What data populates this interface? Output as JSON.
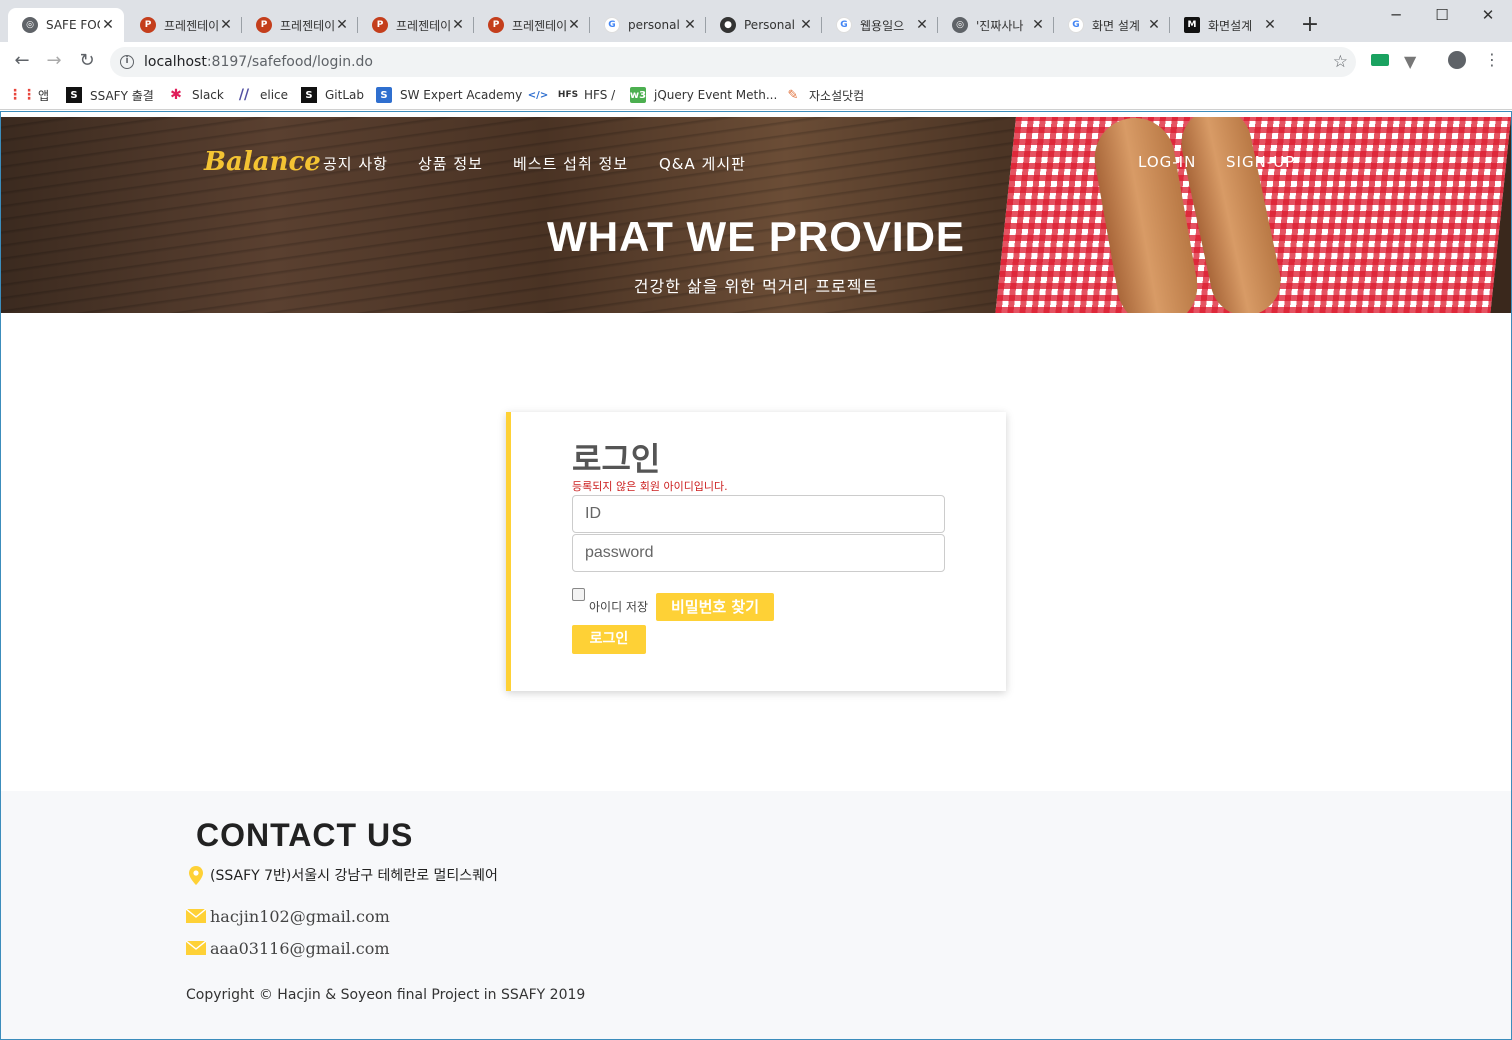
{
  "browser": {
    "tabs": [
      {
        "title": "SAFE FOOD",
        "icon": "globe-icon",
        "active": true
      },
      {
        "title": "프레젠테이션",
        "icon": "powerpoint-icon"
      },
      {
        "title": "프레젠테이션",
        "icon": "powerpoint-icon"
      },
      {
        "title": "프레젠테이션",
        "icon": "powerpoint-icon"
      },
      {
        "title": "프레젠테이션",
        "icon": "powerpoint-icon"
      },
      {
        "title": "personal",
        "icon": "google-icon"
      },
      {
        "title": "Personal",
        "icon": "github-icon"
      },
      {
        "title": "웹용일으",
        "icon": "google-icon"
      },
      {
        "title": "'진짜사나",
        "icon": "globe-icon"
      },
      {
        "title": "화면 설계",
        "icon": "google-icon"
      },
      {
        "title": "화면설계",
        "icon": "medium-icon"
      }
    ],
    "new_tab": "+",
    "url_host": "localhost",
    "url_path": ":8197/safefood/login.do",
    "bookmarks": [
      {
        "label": "앱",
        "icon": "apps-grid-icon"
      },
      {
        "label": "SSAFY 출결",
        "icon": "ssafy-icon"
      },
      {
        "label": "Slack",
        "icon": "slack-icon"
      },
      {
        "label": "elice",
        "icon": "elice-icon"
      },
      {
        "label": "GitLab",
        "icon": "gitlab-icon"
      },
      {
        "label": "SW Expert Academy",
        "icon": "swea-icon"
      },
      {
        "label": "",
        "icon": "code-icon"
      },
      {
        "label": "HFS /",
        "icon": "hfs-icon"
      },
      {
        "label": "jQuery Event Meth...",
        "icon": "w3-icon"
      },
      {
        "label": "자소설닷컴",
        "icon": "pen-icon"
      }
    ]
  },
  "header": {
    "brand": "Balance",
    "nav": [
      "공지 사항",
      "상품 정보",
      "베스트 섭취 정보",
      "Q&A 게시판"
    ],
    "login": "LOG-IN",
    "signup": "SIGN-UP",
    "title": "WHAT WE PROVIDE",
    "subtitle": "건강한 삶을 위한 먹거리 프로젝트"
  },
  "login": {
    "title": "로그인",
    "error": "등록되지 않은 회원 아이디입니다.",
    "id_placeholder": "ID",
    "password_placeholder": "password",
    "remember_label": "아이디 저장",
    "remember_checked": false,
    "find_password": "비밀번호 찾기",
    "submit": "로그인"
  },
  "footer": {
    "title": "CONTACT US",
    "address": "(SSAFY 7반)서울시 강남구 테헤란로 멀티스퀘어",
    "emails": [
      "hacjin102@gmail.com",
      "aaa03116@gmail.com"
    ],
    "copyright": "Copyright © Hacjin & Soyeon final Project in SSAFY 2019"
  },
  "colors": {
    "accent": "#fed136",
    "error": "#cc1f1f",
    "brand": "#f4c433"
  }
}
